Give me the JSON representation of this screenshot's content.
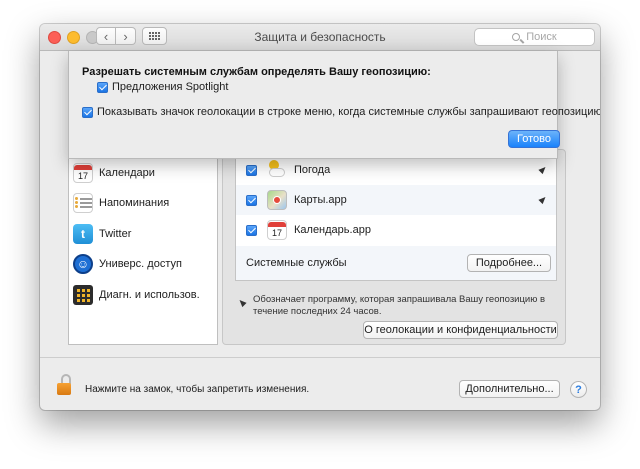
{
  "window": {
    "title": "Защита и безопасность",
    "search_placeholder": "Поиск"
  },
  "sheet": {
    "heading": "Разрешать системным службам определять Вашу геопозицию:",
    "spotlight_label": "Предложения Spotlight",
    "spotlight_checked": true,
    "show_icon_label": "Показывать значок геолокации в строке меню, когда системные службы запрашивают геопозицию",
    "show_icon_checked": true,
    "done_label": "Готово"
  },
  "app_list": [
    {
      "label": "Календари",
      "icon": "calendar-icon"
    },
    {
      "label": "Напоминания",
      "icon": "reminders-icon"
    },
    {
      "label": "Twitter",
      "icon": "twitter-icon"
    },
    {
      "label": "Универс. доступ",
      "icon": "accessibility-icon"
    },
    {
      "label": "Диагн. и использов.",
      "icon": "diagnostics-icon"
    }
  ],
  "services": [
    {
      "label": "Погода",
      "checked": true,
      "icon": "weather-icon",
      "recent": true
    },
    {
      "label": "Карты.app",
      "checked": true,
      "icon": "maps-icon",
      "recent": true
    },
    {
      "label": "Календарь.app",
      "checked": true,
      "icon": "calendar-icon",
      "recent": false
    }
  ],
  "calendar_day": "17",
  "system_services": {
    "label": "Системные службы",
    "details_label": "Подробнее..."
  },
  "note": "Обозначает программу, которая запрашивала Вашу геопозицию в течение последних 24 часов.",
  "about_button": "О геолокации и конфиденциальности",
  "footer": {
    "lock_text": "Нажмите на замок, чтобы запретить изменения.",
    "advanced_label": "Дополнительно...",
    "help_label": "?"
  },
  "colors": {
    "accent": "#1a82fb",
    "window_bg": "#ececec",
    "close": "#fc5f57",
    "minimize": "#fdbc2e"
  }
}
